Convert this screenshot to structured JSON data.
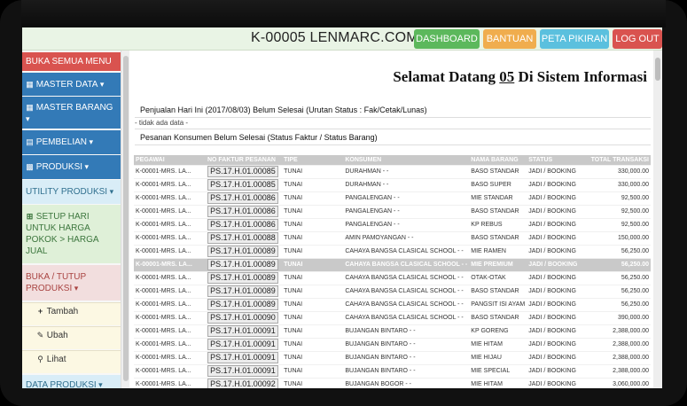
{
  "header": {
    "brand": "K-00005 LENMARC.COM",
    "buttons": {
      "dashboard": "DASHBOARD",
      "bantuan": "BANTUAN",
      "peta": "PETA PIKIRAN",
      "logout": "LOG OUT"
    }
  },
  "sidebar": {
    "buka_semua": "BUKA SEMUA MENU",
    "master_data": "MASTER DATA",
    "master_barang": "MASTER BARANG",
    "pembelian": "PEMBELIAN",
    "produksi": "PRODUKSI",
    "utility": "UTILITY PRODUKSI",
    "setup": "SETUP HARI UNTUK HARGA POKOK > HARGA JUAL",
    "buka_tutup": "BUKA / TUTUP PRODUKSI",
    "tambah": "Tambah",
    "ubah": "Ubah",
    "lihat": "Lihat",
    "data_produksi": "DATA PRODUKSI"
  },
  "main": {
    "welcome_pre": "Selamat Datang ",
    "welcome_num": "05",
    "welcome_post": " Di Sistem Informasi",
    "section1": "Penjualan Hari Ini (2017/08/03) Belum Selesai (Urutan Status : Fak/Cetak/Lunas)",
    "no_data": "- tidak ada data -",
    "section2": "Pesanan Konsumen Belum Selesai (Status Faktur / Status Barang)"
  },
  "table": {
    "headers": [
      "PEGAWAI",
      "NO FAKTUR PESANAN",
      "TIPE",
      "KONSUMEN",
      "NAMA BARANG",
      "STATUS",
      "TOTAL TRANSAKSI"
    ],
    "rows": [
      [
        "K-00001-MRS. LA...",
        "PS.17.H.01.00085",
        "TUNAI",
        "DURAHMAN - -",
        "BASO STANDAR",
        "JADI / BOOKING",
        "330,000.00"
      ],
      [
        "K-00001-MRS. LA...",
        "PS.17.H.01.00085",
        "TUNAI",
        "DURAHMAN - -",
        "BASO SUPER",
        "JADI / BOOKING",
        "330,000.00"
      ],
      [
        "K-00001-MRS. LA...",
        "PS.17.H.01.00086",
        "TUNAI",
        "PANGALENGAN - -",
        "MIE STANDAR",
        "JADI / BOOKING",
        "92,500.00"
      ],
      [
        "K-00001-MRS. LA...",
        "PS.17.H.01.00086",
        "TUNAI",
        "PANGALENGAN - -",
        "BASO STANDAR",
        "JADI / BOOKING",
        "92,500.00"
      ],
      [
        "K-00001-MRS. LA...",
        "PS.17.H.01.00086",
        "TUNAI",
        "PANGALENGAN - -",
        "KP REBUS",
        "JADI / BOOKING",
        "92,500.00"
      ],
      [
        "K-00001-MRS. LA...",
        "PS.17.H.01.00088",
        "TUNAI",
        "AMIN PAMOYANGAN - -",
        "BASO STANDAR",
        "JADI / BOOKING",
        "150,000.00"
      ],
      [
        "K-00001-MRS. LA...",
        "PS.17.H.01.00089",
        "TUNAI",
        "CAHAYA BANGSA CLASICAL SCHOOL - -",
        "MIE RAMEN",
        "JADI / BOOKING",
        "56,250.00"
      ],
      [
        "K-00001-MRS. LA...",
        "PS.17.H.01.00089",
        "TUNAI",
        "CAHAYA BANGSA CLASICAL SCHOOL - -",
        "MIE PREMIUM",
        "JADI / BOOKING",
        "56,250.00"
      ],
      [
        "K-00001-MRS. LA...",
        "PS.17.H.01.00089",
        "TUNAI",
        "CAHAYA BANGSA CLASICAL SCHOOL - -",
        "OTAK-OTAK",
        "JADI / BOOKING",
        "56,250.00"
      ],
      [
        "K-00001-MRS. LA...",
        "PS.17.H.01.00089",
        "TUNAI",
        "CAHAYA BANGSA CLASICAL SCHOOL - -",
        "BASO STANDAR",
        "JADI / BOOKING",
        "56,250.00"
      ],
      [
        "K-00001-MRS. LA...",
        "PS.17.H.01.00089",
        "TUNAI",
        "CAHAYA BANGSA CLASICAL SCHOOL - -",
        "PANGSIT ISI AYAM",
        "JADI / BOOKING",
        "56,250.00"
      ],
      [
        "K-00001-MRS. LA...",
        "PS.17.H.01.00090",
        "TUNAI",
        "CAHAYA BANGSA CLASICAL SCHOOL - -",
        "BASO STANDAR",
        "JADI / BOOKING",
        "390,000.00"
      ],
      [
        "K-00001-MRS. LA...",
        "PS.17.H.01.00091",
        "TUNAI",
        "BUJANGAN BINTARO - -",
        "KP GORENG",
        "JADI / BOOKING",
        "2,388,000.00"
      ],
      [
        "K-00001-MRS. LA...",
        "PS.17.H.01.00091",
        "TUNAI",
        "BUJANGAN BINTARO - -",
        "MIE HITAM",
        "JADI / BOOKING",
        "2,388,000.00"
      ],
      [
        "K-00001-MRS. LA...",
        "PS.17.H.01.00091",
        "TUNAI",
        "BUJANGAN BINTARO - -",
        "MIE HIJAU",
        "JADI / BOOKING",
        "2,388,000.00"
      ],
      [
        "K-00001-MRS. LA...",
        "PS.17.H.01.00091",
        "TUNAI",
        "BUJANGAN BINTARO - -",
        "MIE SPECIAL",
        "JADI / BOOKING",
        "2,388,000.00"
      ],
      [
        "K-00001-MRS. LA...",
        "PS.17.H.01.00092",
        "TUNAI",
        "BUJANGAN BOGOR - -",
        "MIE HITAM",
        "JADI / BOOKING",
        "3,060,000.00"
      ]
    ],
    "highlight_index": 7
  },
  "colors": {
    "success": "#5cb85c",
    "warning": "#f0ad4e",
    "info": "#5bc0de",
    "danger": "#d9534f",
    "primary": "#337ab7"
  }
}
